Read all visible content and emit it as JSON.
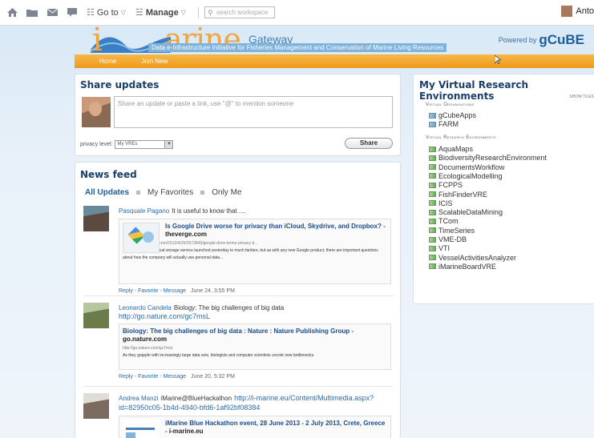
{
  "toolbar": {
    "goto_label": "Go to",
    "manage_label": "Manage",
    "search_placeholder": "search workspace",
    "user_name": "Anto"
  },
  "banner": {
    "logo_first": "i",
    "logo_rest": "arine",
    "logo_gateway": "Gateway",
    "tagline": "Data e-Infrastructure Initiative for Fisheries Management and Conservation of Marine Living Resources",
    "powered_by": "Powered by",
    "gcube": "gCuBE"
  },
  "nav": {
    "items": [
      "Home",
      "Join New"
    ]
  },
  "share": {
    "title": "Share updates",
    "placeholder": "Share an update or paste a link, use \"@\" to mention someone",
    "privacy_label": "privacy level:",
    "privacy_value": "My VREs",
    "button": "Share"
  },
  "feed": {
    "title": "News feed",
    "filters": [
      "All Updates",
      "My Favorites",
      "Only Me"
    ],
    "posts": [
      {
        "author": "Pasquale Pagano",
        "text": "It is useful to know that ....",
        "url": "",
        "card_title": "Is Google Drive worse for privacy than iCloud, Skydrive, and Dropbox?",
        "card_source": "theverge.com",
        "card_url": "http://www.theverge.com/2012/4/25/2973849/google-drive-terms-privacy-d...",
        "card_desc": "The Google Drive cloud storage service launched yesterday to much fanfare, but as with any new Google product, there are important questions about how the company will actually use personal data...",
        "reply": "Reply",
        "favorite": "Favorite",
        "message": "Message",
        "date": "June 24, 3:55 PM"
      },
      {
        "author": "Leonardo Candela",
        "text": "Biology: The big challenges of big data",
        "url": "http://go.nature.com/gc7msL",
        "card_title": "Biology: The big challenges of big data : Nature : Nature Publishing Group",
        "card_source": "go.nature.com",
        "card_url": "http://go.nature.com/gc7msL",
        "card_desc": "As they grapple with increasingly large data sets, biologists and computer scientists uncork new bottlenecks.",
        "reply": "Reply",
        "favorite": "Favorite",
        "message": "Message",
        "date": "June 20, 5:32 PM"
      },
      {
        "author": "Andrea Manzi",
        "text": "iMarine@BlueHackathon",
        "url": "http://i-marine.eu/Content/Multimedia.aspx?id=82950c05-1b4d-4940-bfd6-1af92bf08384",
        "card_title": "iMarine Blue Hackathon event, 28 June 2013 - 2 July 2013, Crete, Greece",
        "card_source": "i-marine.eu"
      }
    ]
  },
  "vre": {
    "title": "My Virtual Research Environments",
    "show_tiles": "SHOW TILES",
    "org_section": "Virtual Organizations",
    "orgs": [
      "gCubeApps",
      "FARM"
    ],
    "env_section": "Virtual Research Environments",
    "envs": [
      "AquaMaps",
      "BiodiversityResearchEnvironment",
      "DocumentsWorkflow",
      "EcologicalModelling",
      "FCPPS",
      "FishFinderVRE",
      "ICIS",
      "ScalableDataMining",
      "TCom",
      "TimeSeries",
      "VME-DB",
      "VTI",
      "VesselActivitiesAnalyzer",
      "iMarineBoardVRE"
    ]
  }
}
